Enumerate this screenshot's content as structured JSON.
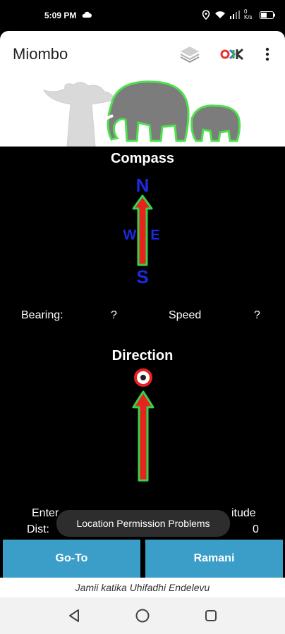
{
  "status": {
    "time": "5:09 PM",
    "net_speed": "0 K/s"
  },
  "app": {
    "title": "Miombo"
  },
  "compass": {
    "title": "Compass",
    "north": "N",
    "south": "S",
    "west": "W",
    "east": "E",
    "bearing_label": "Bearing:",
    "bearing_value": "?",
    "speed_label": "Speed",
    "speed_value": "?"
  },
  "direction": {
    "title": "Direction"
  },
  "entry": {
    "left_label": "Enter",
    "right_label": "itude",
    "dist_label": "Dist:",
    "dist_value": "0"
  },
  "toast": {
    "message": "Location Permission Problems"
  },
  "buttons": {
    "goto": "Go-To",
    "ramani": "Ramani"
  },
  "footer": {
    "text": "Jamii katika Uhifadhi Endelevu"
  },
  "colors": {
    "button": "#3b9ec9",
    "arrow_fill": "#e6231f",
    "arrow_outline": "#35d34a",
    "compass_letters": "#1a2be0"
  }
}
